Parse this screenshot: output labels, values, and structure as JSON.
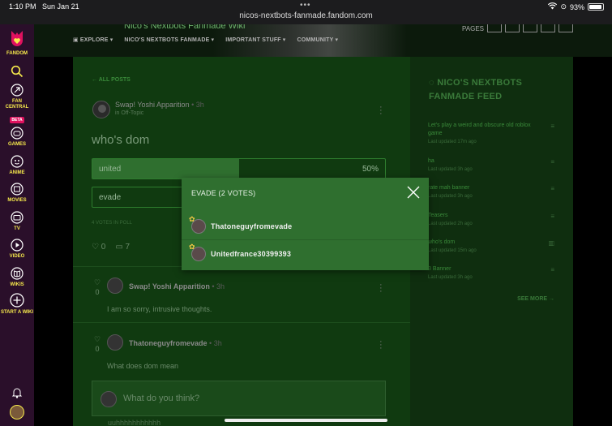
{
  "status": {
    "time": "1:10 PM",
    "date": "Sun Jan 21",
    "url": "nicos-nextbots-fanmade.fandom.com",
    "battery": "93%",
    "battery_fraction": 0.93
  },
  "rail": {
    "items": [
      {
        "label": "FANDOM",
        "icon": "fandom-logo"
      },
      {
        "label": "",
        "icon": "search-icon"
      },
      {
        "label": "FAN CENTRAL",
        "icon": "rocket-icon",
        "badge": "BETA"
      },
      {
        "label": "GAMES",
        "icon": "gamepad-icon"
      },
      {
        "label": "ANIME",
        "icon": "anime-icon"
      },
      {
        "label": "MOVIES",
        "icon": "movie-icon"
      },
      {
        "label": "TV",
        "icon": "tv-icon"
      },
      {
        "label": "VIDEO",
        "icon": "video-icon"
      },
      {
        "label": "WIKIS",
        "icon": "book-icon"
      },
      {
        "label": "START A WIKI",
        "icon": "plus-circle-icon"
      }
    ]
  },
  "header": {
    "title": "Nico's Nextbots Fanmade Wiki",
    "nav": [
      "EXPLORE",
      "NICO'S NEXTBOTS FANMADE",
      "IMPORTANT STUFF",
      "COMMUNITY"
    ],
    "pages_label": "PAGES"
  },
  "post": {
    "back_label": "ALL POSTS",
    "author": "Swap! Yoshi Apparition",
    "time": "3h",
    "category": "in Off-Topic",
    "title": "who's dom",
    "poll": [
      {
        "label": "united",
        "percent_text": "50%",
        "fraction": 0.5
      },
      {
        "label": "evade",
        "percent_text": "",
        "fraction": 0
      }
    ],
    "votes_text": "4 VOTES IN POLL",
    "likes": "0",
    "comments": "7"
  },
  "replies": [
    {
      "author": "Swap! Yoshi Apparition",
      "time": "3h",
      "likes": "0",
      "text": "I am so sorry, intrusive thoughts."
    },
    {
      "author": "Thatoneguyfromevade",
      "time": "3h",
      "likes": "0",
      "text": "What does dom mean"
    }
  ],
  "composer": {
    "placeholder": "What do you think?",
    "next_reply_preview": "uuhhhhhhhhhhh"
  },
  "feed": {
    "title": "NICO'S NEXTBOTS FANMADE FEED",
    "items": [
      {
        "title": "Let's play a weird and obscure old roblox game",
        "updated": "Last updated 17m ago",
        "icon": "list-icon"
      },
      {
        "title": "ha",
        "updated": "Last updated 3h ago",
        "icon": "list-icon"
      },
      {
        "title": "rate mah banner",
        "updated": "Last updated 3h ago",
        "icon": "list-icon"
      },
      {
        "title": "Teasers",
        "updated": "Last updated 2h ago",
        "icon": "list-icon"
      },
      {
        "title": "who's dom",
        "updated": "Last updated 15m ago",
        "icon": "poll-icon"
      },
      {
        "title": "3 Banner",
        "updated": "Last updated 3h ago",
        "icon": "list-icon"
      }
    ],
    "see_more": "SEE MORE"
  },
  "modal": {
    "title": "EVADE (2 VOTES)",
    "voters": [
      "Thatoneguyfromevade",
      "Unitedfrance30399393"
    ]
  },
  "colors": {
    "rail_bg": "#2a0f2a",
    "rail_label": "#f6e94c",
    "content_bg": "#103a10",
    "modal_bg": "#2f6f2f",
    "beta": "#e0115f"
  }
}
